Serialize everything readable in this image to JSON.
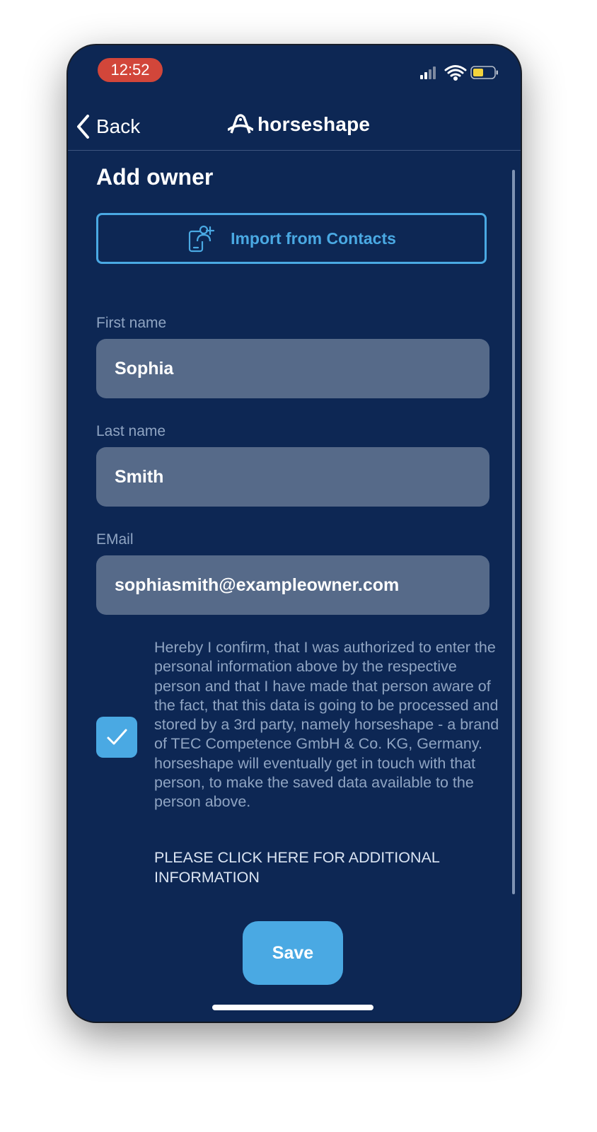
{
  "status": {
    "time": "12:52"
  },
  "nav": {
    "back_label": "Back",
    "brand": "horseshape"
  },
  "page": {
    "title": "Add owner"
  },
  "import": {
    "label": "Import from Contacts"
  },
  "fields": {
    "first_name": {
      "label": "First name",
      "value": "Sophia"
    },
    "last_name": {
      "label": "Last name",
      "value": "Smith"
    },
    "email": {
      "label": "EMail",
      "value": "sophiasmith@exampleowner.com"
    }
  },
  "consent": {
    "checked": true,
    "text": "Hereby I confirm, that I was authorized to enter the personal information above by the respective person and that I have made that person aware of the fact, that this data is going to be processed and stored by a 3rd party, namely horseshape - a brand of TEC Competence GmbH & Co. KG, Germany. horseshape will eventually get in touch with that person, to make the saved data available to the person above.",
    "link": "PLEASE CLICK HERE FOR ADDITIONAL INFORMATION"
  },
  "save": {
    "label": "Save"
  },
  "colors": {
    "background": "#0d2754",
    "accent": "#4aa9e3",
    "field": "#566a89",
    "time_pill": "#d2463a",
    "battery": "#f2d33c"
  }
}
